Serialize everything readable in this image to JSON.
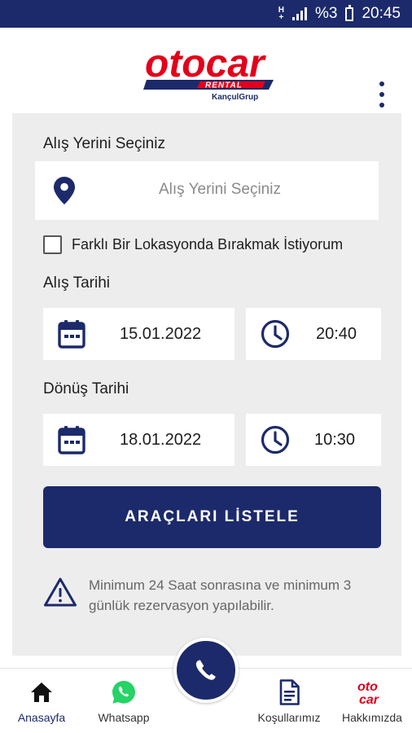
{
  "status_bar": {
    "signal_label": "H",
    "battery": "%3",
    "time": "20:45"
  },
  "header": {
    "brand": "otocar",
    "brand_sub": "RENTAL",
    "brand_group": "KançulGrup"
  },
  "form": {
    "pickup_label": "Alış Yerini Seçiniz",
    "pickup_placeholder": "Alış Yerini Seçiniz",
    "different_dropoff_label": "Farklı Bir Lokasyonda Bırakmak İstiyorum",
    "different_dropoff_checked": false,
    "pickup_date_label": "Alış Tarihi",
    "pickup_date": "15.01.2022",
    "pickup_time": "20:40",
    "return_date_label": "Dönüş Tarihi",
    "return_date": "18.01.2022",
    "return_time": "10:30",
    "submit_label": "ARAÇLARI LİSTELE",
    "notice": "Minimum 24 Saat sonrasına ve minimum 3 günlük rezervasyon yapılabilir."
  },
  "bottom_nav": {
    "items": [
      {
        "label": "Anasayfa",
        "icon": "home-icon",
        "active": true
      },
      {
        "label": "Whatsapp",
        "icon": "whatsapp-icon",
        "active": false
      },
      {
        "label": "Koşullarımız",
        "icon": "document-icon",
        "active": false
      },
      {
        "label": "Hakkımızda",
        "icon": "otocar-logo-icon",
        "active": false
      }
    ],
    "center_action_icon": "phone-icon"
  },
  "colors": {
    "primary": "#1c2a6b",
    "brand_red": "#e3001b",
    "panel_bg": "#ededed",
    "whatsapp": "#25d366"
  }
}
